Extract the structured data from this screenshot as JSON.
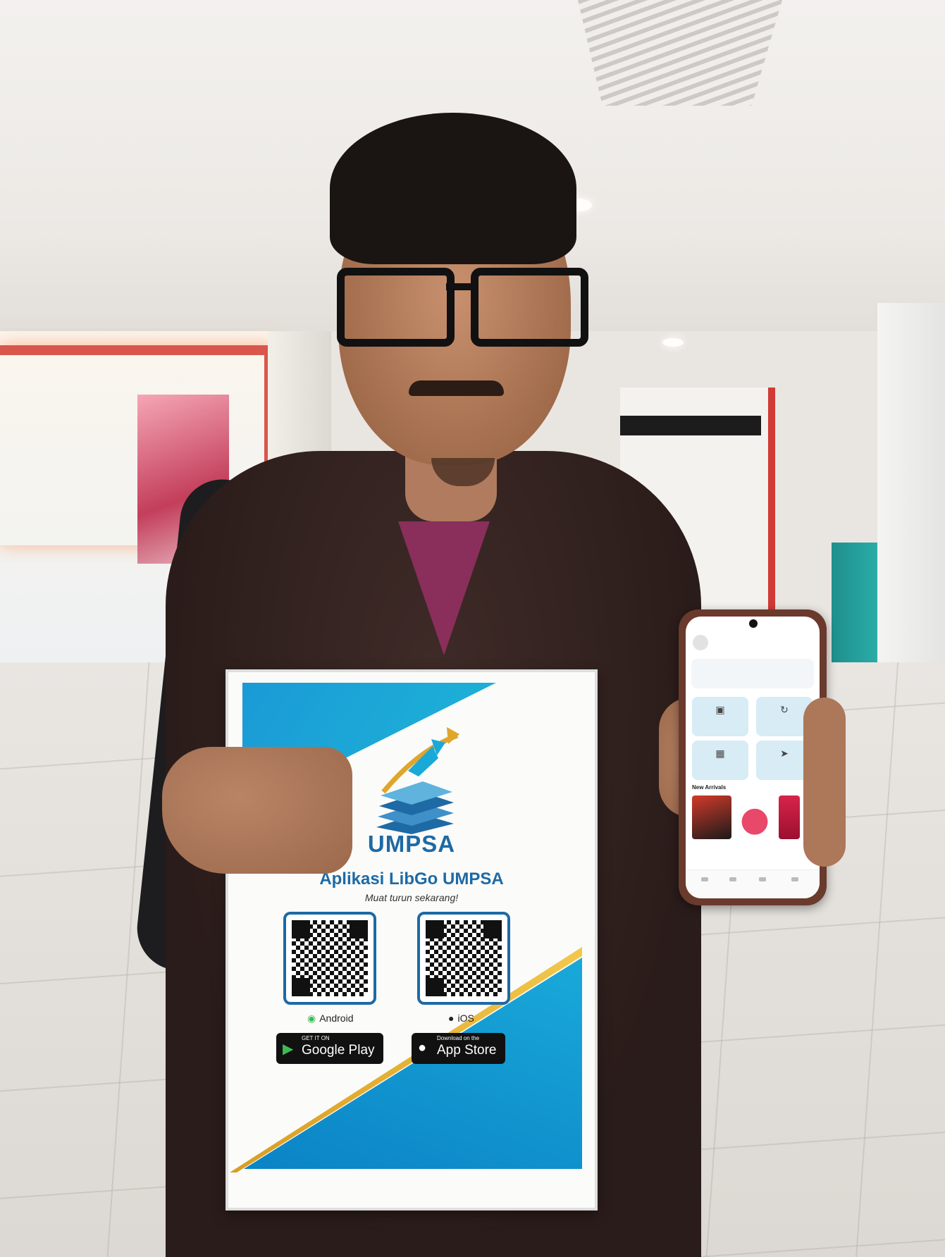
{
  "flyer": {
    "brand": "UMPSA",
    "title": "Aplikasi LibGo UMPSA",
    "subtitle": "Muat turun sekarang!",
    "android_label": "Android",
    "ios_label": "iOS",
    "google_play": {
      "small": "GET IT ON",
      "big": "Google Play"
    },
    "app_store": {
      "small": "Download on the",
      "big": "App Store"
    }
  },
  "phone": {
    "section_title": "New Arrivals"
  },
  "colors": {
    "brand_blue": "#1d6aa5",
    "accent_gold": "#e0a52b",
    "shirt": "#2a1c1a",
    "collar_accent": "#8a2e5b"
  }
}
